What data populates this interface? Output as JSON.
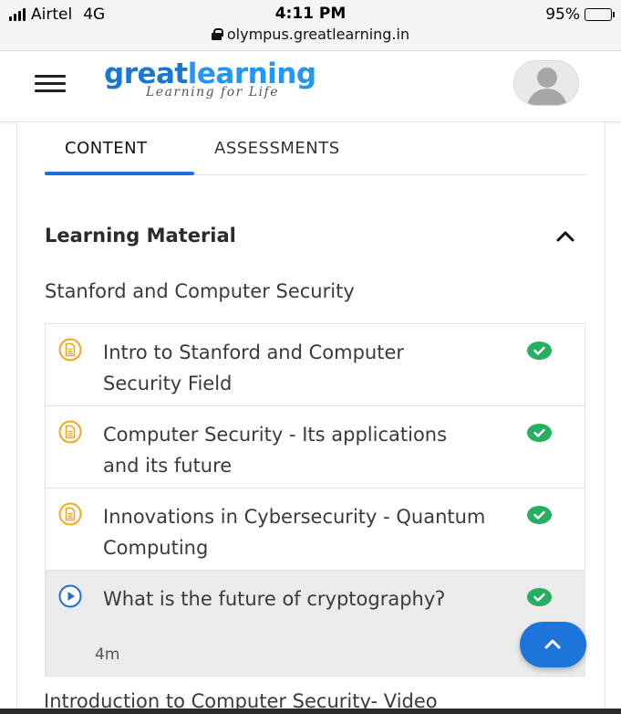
{
  "status_bar": {
    "carrier": "Airtel",
    "network": "4G",
    "time": "4:11 PM",
    "battery": "95%",
    "url": "olympus.greatlearning.in"
  },
  "header": {
    "logo_part1": "great",
    "logo_part2": "learning",
    "tagline": "Learning for Life"
  },
  "tabs": [
    {
      "label": "CONTENT",
      "active": true
    },
    {
      "label": "ASSESSMENTS",
      "active": false
    }
  ],
  "section": {
    "title": "Learning Material",
    "subsection": "Stanford and Computer Security"
  },
  "items": [
    {
      "title": "Intro to Stanford and Computer Security Field",
      "type": "document",
      "completed": true
    },
    {
      "title": "Computer Security - Its applications and its future",
      "type": "document",
      "completed": true
    },
    {
      "title": "Innovations in Cybersecurity - Quantum Computing",
      "type": "document",
      "completed": true
    },
    {
      "title": "What is the future of cryptographyʔ",
      "type": "video",
      "completed": true,
      "duration": "4m"
    }
  ],
  "next_section": "Introduction to Computer Security- Video",
  "colors": {
    "accent": "#1e6fd9",
    "doc_icon": "#f5a623",
    "check": "#27ae60",
    "fab": "#1d75dc"
  }
}
